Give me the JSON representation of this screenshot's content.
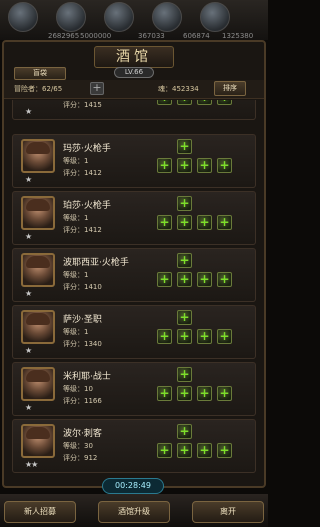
{
  "resources": [
    "2682965",
    "5000000",
    "367033",
    "606874",
    "1325380"
  ],
  "title": "酒馆",
  "level_badge": "LV.66",
  "tab_label": "盲袋",
  "adventurers": "冒险者：62/65",
  "add_symbol": "+",
  "soul": "魂：452334",
  "sort_label": "排序",
  "partial_card": {
    "score": "评分：1415"
  },
  "heroes": [
    {
      "name": "玛莎·火枪手",
      "level": "等级：1",
      "score": "评分：1412",
      "stars": "★"
    },
    {
      "name": "珀莎·火枪手",
      "level": "等级：1",
      "score": "评分：1412",
      "stars": "★"
    },
    {
      "name": "波耶西亚·火枪手",
      "level": "等级：1",
      "score": "评分：1410",
      "stars": "★"
    },
    {
      "name": "萨沙·圣职",
      "level": "等级：1",
      "score": "评分：1340",
      "stars": "★"
    },
    {
      "name": "米利耶·战士",
      "level": "等级：10",
      "score": "评分：1166",
      "stars": "★"
    },
    {
      "name": "波尔·刺客",
      "level": "等级：30",
      "score": "评分：912",
      "stars": "★★"
    }
  ],
  "plus_glyph": "+",
  "timer": "00:28:49",
  "buttons": {
    "recruit": "新人招募",
    "upgrade": "酒馆升级",
    "leave": "离开"
  },
  "icons": {
    "slot": "plus-slot-icon",
    "add": "plus-icon"
  },
  "colors": {
    "accent_green": "#7ddf2a",
    "gold_border": "#8a6a3a",
    "timer_cyan": "#a8f0ff"
  }
}
